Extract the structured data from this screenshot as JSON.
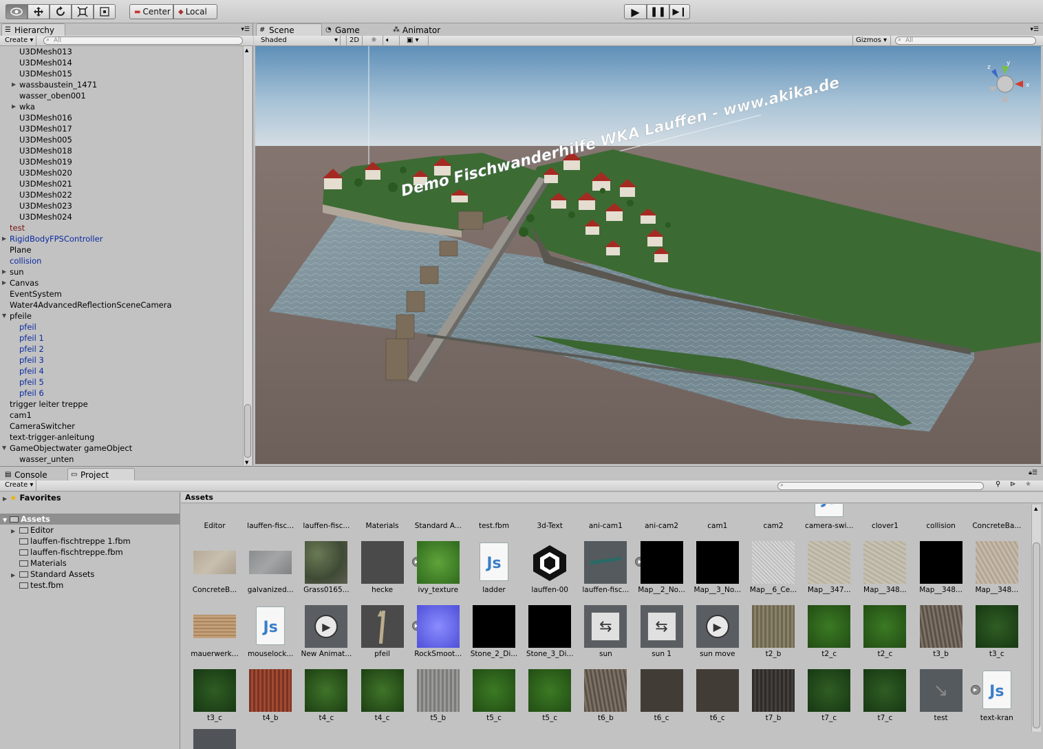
{
  "toolbar": {
    "center_label": "Center",
    "local_label": "Local"
  },
  "hierarchy": {
    "tab_label": "Hierarchy",
    "create_label": "Create",
    "search_placeholder": "All",
    "rows": [
      {
        "label": "U3DMesh013",
        "indent": 2,
        "arrow": "",
        "color": "#000"
      },
      {
        "label": "U3DMesh014",
        "indent": 2,
        "arrow": "",
        "color": "#000"
      },
      {
        "label": "U3DMesh015",
        "indent": 2,
        "arrow": "",
        "color": "#000"
      },
      {
        "label": "wassbaustein_1471",
        "indent": 2,
        "arrow": "▶",
        "color": "#000"
      },
      {
        "label": "wasser_oben001",
        "indent": 2,
        "arrow": "",
        "color": "#000"
      },
      {
        "label": "wka",
        "indent": 2,
        "arrow": "▶",
        "color": "#000"
      },
      {
        "label": "U3DMesh016",
        "indent": 2,
        "arrow": "",
        "color": "#000"
      },
      {
        "label": "U3DMesh017",
        "indent": 2,
        "arrow": "",
        "color": "#000"
      },
      {
        "label": "U3DMesh005",
        "indent": 2,
        "arrow": "",
        "color": "#000"
      },
      {
        "label": "U3DMesh018",
        "indent": 2,
        "arrow": "",
        "color": "#000"
      },
      {
        "label": "U3DMesh019",
        "indent": 2,
        "arrow": "",
        "color": "#000"
      },
      {
        "label": "U3DMesh020",
        "indent": 2,
        "arrow": "",
        "color": "#000"
      },
      {
        "label": "U3DMesh021",
        "indent": 2,
        "arrow": "",
        "color": "#000"
      },
      {
        "label": "U3DMesh022",
        "indent": 2,
        "arrow": "",
        "color": "#000"
      },
      {
        "label": "U3DMesh023",
        "indent": 2,
        "arrow": "",
        "color": "#000"
      },
      {
        "label": "U3DMesh024",
        "indent": 2,
        "arrow": "",
        "color": "#000"
      },
      {
        "label": "test",
        "indent": 1,
        "arrow": "",
        "color": "#7a1010"
      },
      {
        "label": "RigidBodyFPSController",
        "indent": 1,
        "arrow": "▶",
        "color": "#0a2aa0"
      },
      {
        "label": "Plane",
        "indent": 1,
        "arrow": "",
        "color": "#000"
      },
      {
        "label": "collision",
        "indent": 1,
        "arrow": "",
        "color": "#0a2aa0"
      },
      {
        "label": "sun",
        "indent": 1,
        "arrow": "▶",
        "color": "#000"
      },
      {
        "label": "Canvas",
        "indent": 1,
        "arrow": "▶",
        "color": "#000"
      },
      {
        "label": "EventSystem",
        "indent": 1,
        "arrow": "",
        "color": "#000"
      },
      {
        "label": "Water4AdvancedReflectionSceneCamera",
        "indent": 1,
        "arrow": "",
        "color": "#000"
      },
      {
        "label": "pfeile",
        "indent": 1,
        "arrow": "▼",
        "color": "#000"
      },
      {
        "label": "pfeil",
        "indent": 2,
        "arrow": "",
        "color": "#0a2aa0"
      },
      {
        "label": "pfeil 1",
        "indent": 2,
        "arrow": "",
        "color": "#0a2aa0"
      },
      {
        "label": "pfeil 2",
        "indent": 2,
        "arrow": "",
        "color": "#0a2aa0"
      },
      {
        "label": "pfeil 3",
        "indent": 2,
        "arrow": "",
        "color": "#0a2aa0"
      },
      {
        "label": "pfeil 4",
        "indent": 2,
        "arrow": "",
        "color": "#0a2aa0"
      },
      {
        "label": "pfeil 5",
        "indent": 2,
        "arrow": "",
        "color": "#0a2aa0"
      },
      {
        "label": "pfeil 6",
        "indent": 2,
        "arrow": "",
        "color": "#0a2aa0"
      },
      {
        "label": "trigger leiter treppe",
        "indent": 1,
        "arrow": "",
        "color": "#000"
      },
      {
        "label": "cam1",
        "indent": 1,
        "arrow": "",
        "color": "#000"
      },
      {
        "label": "CameraSwitcher",
        "indent": 1,
        "arrow": "",
        "color": "#000"
      },
      {
        "label": "text-trigger-anleitung",
        "indent": 1,
        "arrow": "",
        "color": "#000"
      },
      {
        "label": "GameObjectwater gameObject",
        "indent": 1,
        "arrow": "▼",
        "color": "#000"
      },
      {
        "label": "wasser_unten",
        "indent": 2,
        "arrow": "",
        "color": "#000"
      }
    ]
  },
  "scene": {
    "tabs": [
      {
        "label": "Scene"
      },
      {
        "label": "Game"
      },
      {
        "label": "Animator"
      }
    ],
    "shaded_label": "Shaded",
    "mode_2d_label": "2D",
    "gizmos_label": "Gizmos",
    "search_placeholder": "All",
    "overlay_text": "Demo Fischwanderhilfe WKA Lauffen - www.akika.de",
    "gizmo_axes": {
      "x": "x",
      "y": "y",
      "z": "z"
    }
  },
  "bottom": {
    "tabs": [
      {
        "label": "Console"
      },
      {
        "label": "Project"
      }
    ],
    "create_label": "Create",
    "favorites_label": "Favorites",
    "assets_label": "Assets",
    "breadcrumb": "Assets",
    "folders": [
      {
        "label": "Editor",
        "arrow": "▶"
      },
      {
        "label": "lauffen-fischtreppe 1.fbm",
        "arrow": ""
      },
      {
        "label": "lauffen-fischtreppe.fbm",
        "arrow": ""
      },
      {
        "label": "Materials",
        "arrow": ""
      },
      {
        "label": "Standard Assets",
        "arrow": "▶"
      },
      {
        "label": "test.fbm",
        "arrow": ""
      }
    ],
    "asset_rows": [
      [
        {
          "label": "Editor",
          "kind": "folder"
        },
        {
          "label": "lauffen-fisc...",
          "kind": "folder"
        },
        {
          "label": "lauffen-fisc...",
          "kind": "folder"
        },
        {
          "label": "Materials",
          "kind": "folder"
        },
        {
          "label": "Standard A...",
          "kind": "folder"
        },
        {
          "label": "test.fbm",
          "kind": "folder"
        },
        {
          "label": "3d-Text",
          "kind": "yellow"
        },
        {
          "label": "ani-cam1",
          "kind": "dark"
        },
        {
          "label": "ani-cam2",
          "kind": "dark"
        },
        {
          "label": "cam1",
          "kind": "dark"
        },
        {
          "label": "cam2",
          "kind": "dark"
        },
        {
          "label": "camera-swi...",
          "kind": "js"
        },
        {
          "label": "clover1",
          "kind": "green"
        },
        {
          "label": "collision",
          "kind": "dark"
        },
        {
          "label": "ConcreteBa...",
          "kind": "none"
        }
      ],
      [
        {
          "label": "ConcreteB...",
          "kind": "concrete"
        },
        {
          "label": "galvanized...",
          "kind": "metal"
        },
        {
          "label": "Grass0165...",
          "kind": "grass"
        },
        {
          "label": "hecke",
          "kind": "darkplay"
        },
        {
          "label": "ivy_texture",
          "kind": "ivy"
        },
        {
          "label": "ladder",
          "kind": "js"
        },
        {
          "label": "lauffen-00",
          "kind": "unity"
        },
        {
          "label": "lauffen-fisc...",
          "kind": "modelplay"
        },
        {
          "label": "Map__2_No...",
          "kind": "black"
        },
        {
          "label": "Map__3_No...",
          "kind": "black"
        },
        {
          "label": "Map__6_Ce...",
          "kind": "noise"
        },
        {
          "label": "Map__347...",
          "kind": "stone"
        },
        {
          "label": "Map__348...",
          "kind": "stone"
        },
        {
          "label": "Map__348...",
          "kind": "black"
        },
        {
          "label": "Map__348...",
          "kind": "stone2"
        }
      ],
      [
        {
          "label": "mauerwerk...",
          "kind": "brick"
        },
        {
          "label": "mouselock...",
          "kind": "js"
        },
        {
          "label": "New Animat...",
          "kind": "anim"
        },
        {
          "label": "pfeil",
          "kind": "pfeil"
        },
        {
          "label": "RockSmoot...",
          "kind": "normal"
        },
        {
          "label": "Stone_2_Di...",
          "kind": "black"
        },
        {
          "label": "Stone_3_Di...",
          "kind": "black"
        },
        {
          "label": "sun",
          "kind": "animctrl"
        },
        {
          "label": "sun 1",
          "kind": "animctrl"
        },
        {
          "label": "sun move",
          "kind": "anim"
        },
        {
          "label": "t2_b",
          "kind": "bark"
        },
        {
          "label": "t2_c",
          "kind": "leaf"
        },
        {
          "label": "t2_c",
          "kind": "leaf"
        },
        {
          "label": "t3_b",
          "kind": "bark2"
        },
        {
          "label": "t3_c",
          "kind": "leafdark"
        }
      ],
      [
        {
          "label": "t3_c",
          "kind": "leafdark"
        },
        {
          "label": "t4_b",
          "kind": "redbark"
        },
        {
          "label": "t4_c",
          "kind": "leaf2"
        },
        {
          "label": "t4_c",
          "kind": "leaf2"
        },
        {
          "label": "t5_b",
          "kind": "graybark"
        },
        {
          "label": "t5_c",
          "kind": "leaf"
        },
        {
          "label": "t5_c",
          "kind": "leaf"
        },
        {
          "label": "t6_b",
          "kind": "bark2"
        },
        {
          "label": "t6_c",
          "kind": "twig"
        },
        {
          "label": "t6_c",
          "kind": "twig"
        },
        {
          "label": "t7_b",
          "kind": "darkbark"
        },
        {
          "label": "t7_c",
          "kind": "leafdark"
        },
        {
          "label": "t7_c",
          "kind": "leafdark"
        },
        {
          "label": "test",
          "kind": "testmodel"
        },
        {
          "label": "text-kran",
          "kind": "js"
        }
      ]
    ]
  },
  "colors": {
    "accent_blue": "#0a2aa0",
    "prefab_red": "#7a1010",
    "panel_bg": "#c2c2c2",
    "selection": "#8f8f8f"
  }
}
